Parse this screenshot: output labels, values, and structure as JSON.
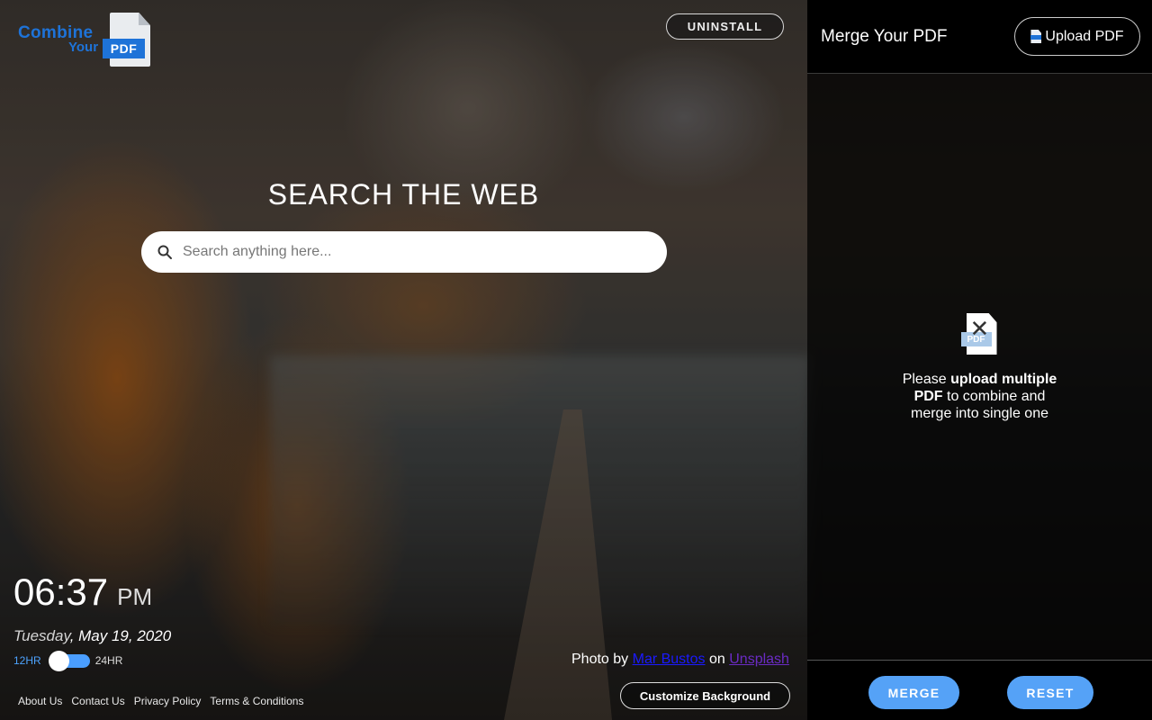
{
  "logo": {
    "line1": "Combine",
    "line2": "Your",
    "tag": "PDF",
    "brand_color": "#1e73d8"
  },
  "header": {
    "uninstall_label": "UNINSTALL"
  },
  "search": {
    "title": "SEARCH THE WEB",
    "placeholder": "Search anything here...",
    "value": "",
    "icon": "search-icon"
  },
  "clock": {
    "time": "06:37",
    "ampm": "PM",
    "day": "Tuesday",
    "date": ", May 19, 2020",
    "format_left": "12HR",
    "format_right": "24HR",
    "selected_format": "12HR"
  },
  "footer": {
    "links": [
      "About Us",
      "Contact Us",
      "Privacy Policy",
      "Terms & Conditions"
    ]
  },
  "credit": {
    "prefix": "Photo by",
    "photographer": "Mar Bustos",
    "middle": "on",
    "site": "Unsplash"
  },
  "customize_label": "Customize Background",
  "panel": {
    "title": "Merge Your PDF",
    "upload_label": "Upload PDF",
    "empty_icon_tag": "PDF",
    "empty_text_1": "Please ",
    "empty_text_bold_1": "upload multiple PDF",
    "empty_text_2": " to combine and merge into single one",
    "merge_label": "MERGE",
    "reset_label": "RESET",
    "accent_color": "#55a2f7"
  }
}
